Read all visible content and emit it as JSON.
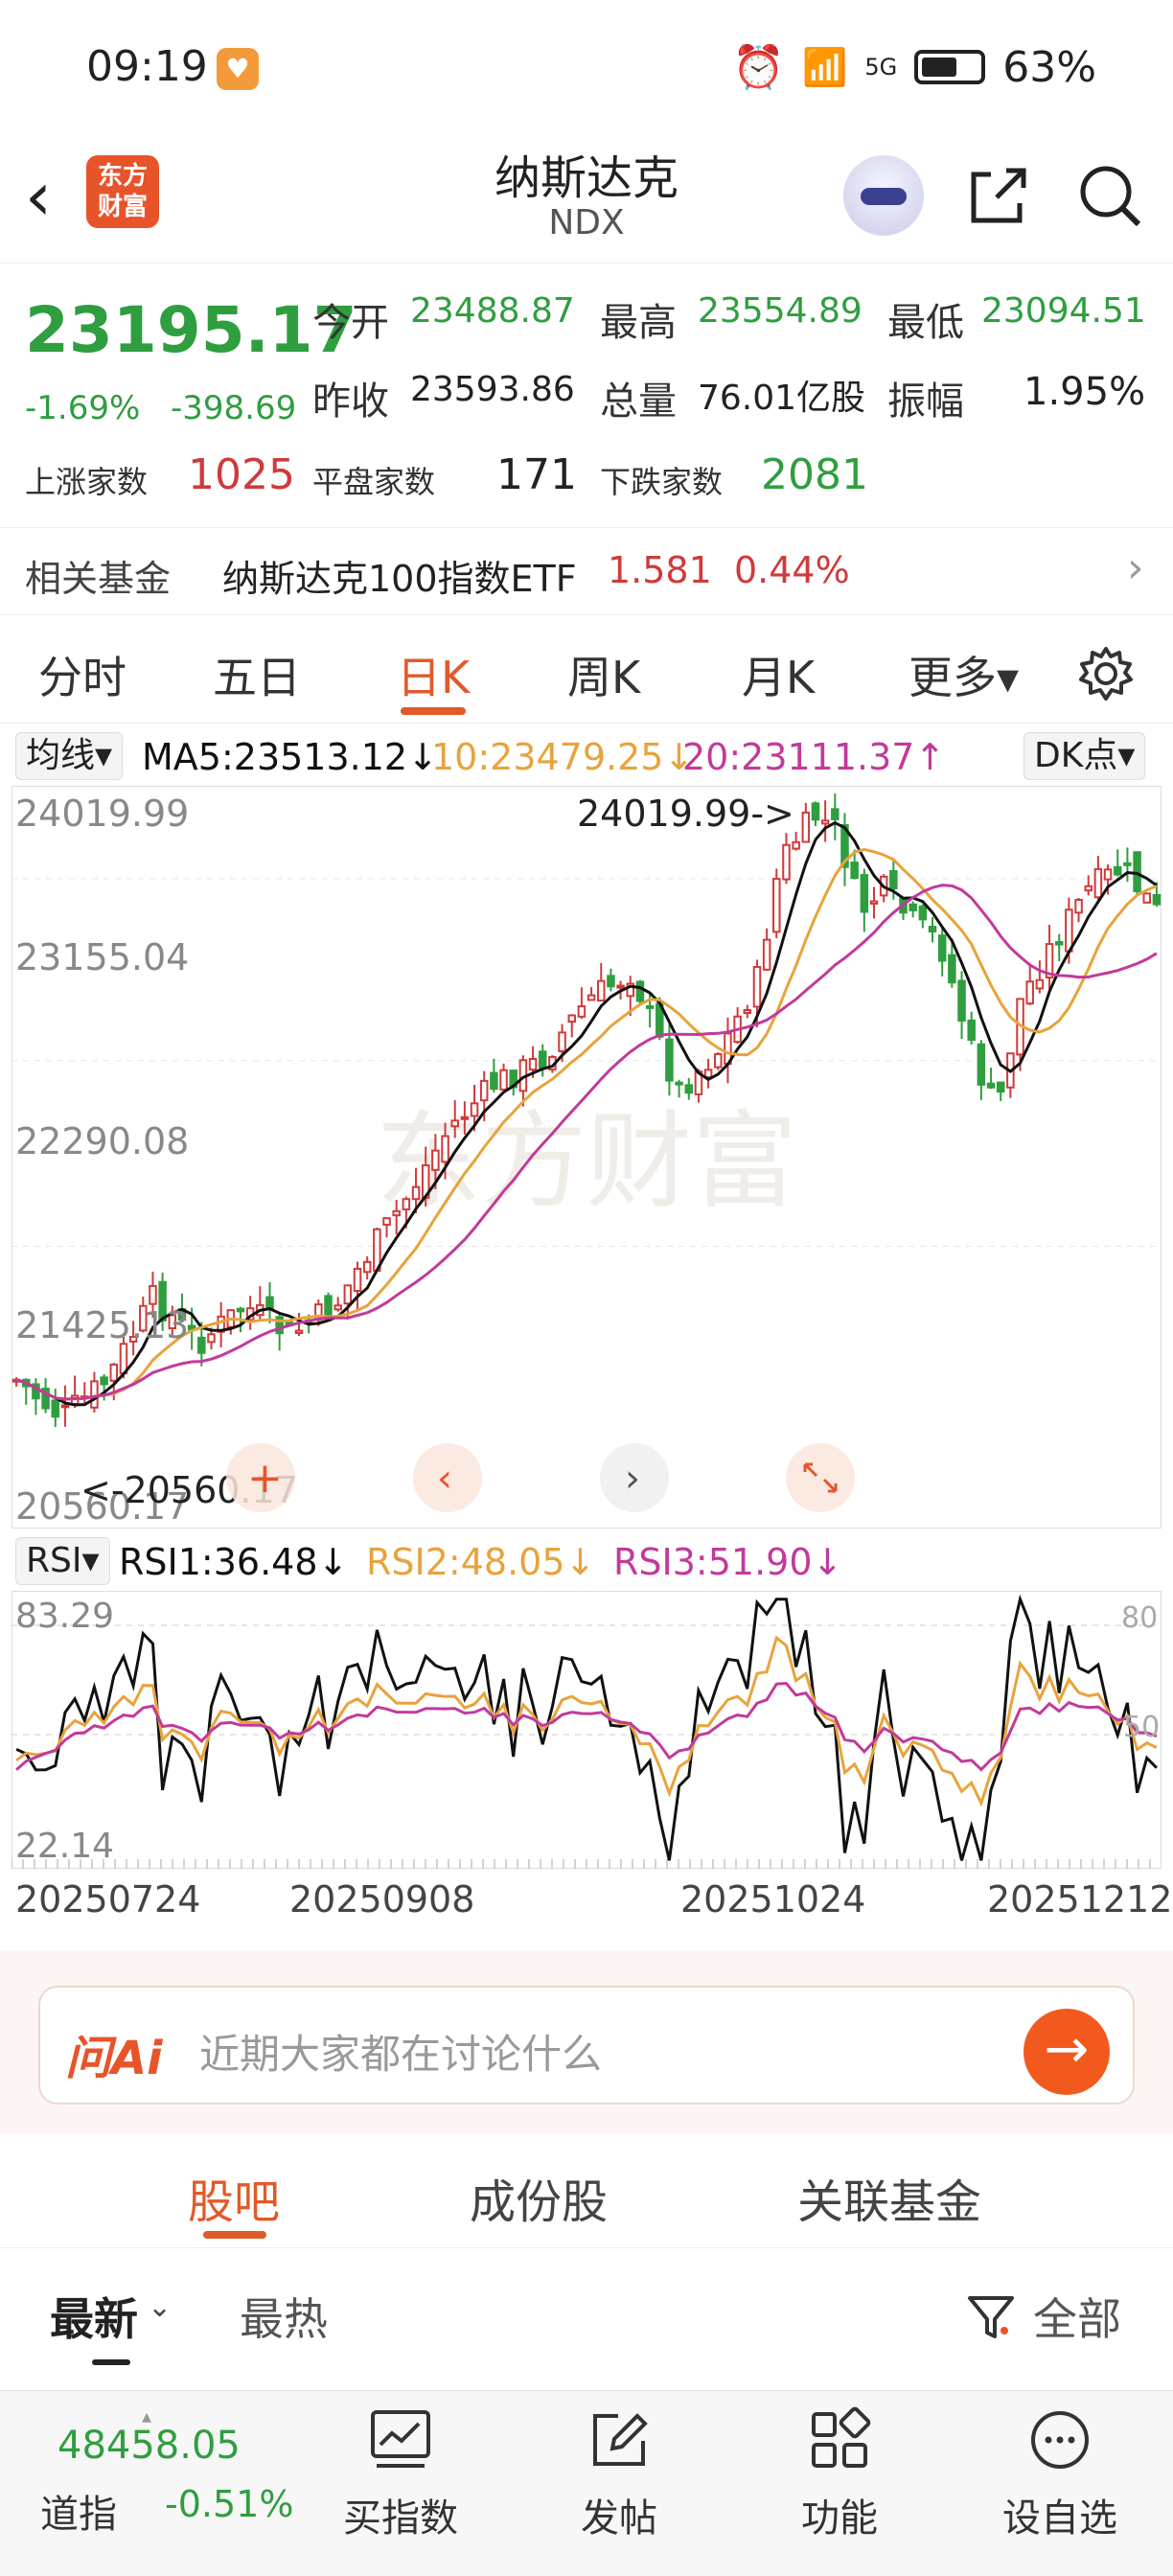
{
  "status_bar": {
    "time": "09:19",
    "signal": "5G",
    "battery": "63%"
  },
  "header": {
    "logo_text": "东方财富",
    "title": "纳斯达克",
    "subtitle": "NDX"
  },
  "quote": {
    "price": "23195.17",
    "change_pct": "-1.69%",
    "change_abs": "-398.69",
    "open_label": "今开",
    "open": "23488.87",
    "high_label": "最高",
    "high": "23554.89",
    "low_label": "最低",
    "low": "23094.51",
    "prev_close_label": "昨收",
    "prev_close": "23593.86",
    "volume_label": "总量",
    "volume": "76.01亿股",
    "amplitude_label": "振幅",
    "amplitude": "1.95%",
    "up_label": "上涨家数",
    "up_count": "1025",
    "flat_label": "平盘家数",
    "flat_count": "171",
    "down_label": "下跌家数",
    "down_count": "2081"
  },
  "fund": {
    "label": "相关基金",
    "name": "纳斯达克100指数ETF",
    "price": "1.581",
    "pct": "0.44%",
    "arrow": "›"
  },
  "period_tabs": [
    "分时",
    "五日",
    "日K",
    "周K",
    "月K",
    "更多▾"
  ],
  "active_period": "日K",
  "ma_legend": {
    "selector": "均线▾",
    "ma5": "MA5:23513.12↓",
    "ma10": "10:23479.25↓",
    "ma20": "20:23111.37↑",
    "dk_button": "DK点▾"
  },
  "kline": {
    "y_labels": [
      "24019.99",
      "23155.04",
      "22290.08",
      "21425.13",
      "20560.17"
    ],
    "max_annotation": "24019.99->",
    "min_annotation": "<-20560.17",
    "watermark": "东方财富",
    "colors": {
      "up": "#d03a3a",
      "down": "#2f9e3f",
      "ma5": "#111111",
      "ma10": "#e8a33c",
      "ma20": "#c23a9a"
    }
  },
  "rsi_legend": {
    "selector": "RSI▾",
    "rsi1": "RSI1:36.48↓",
    "rsi2": "RSI2:48.05↓",
    "rsi3": "RSI3:51.90↓"
  },
  "rsi": {
    "top_label": "83.29",
    "bottom_label": "22.14",
    "right_80": "80",
    "right_50": "50"
  },
  "dates": [
    "20250724",
    "20250908",
    "20251024",
    "20251212"
  ],
  "ai": {
    "logo": "问Ai",
    "placeholder": "近期大家都在讨论什么",
    "go": "→"
  },
  "sub_tabs": [
    "股吧",
    "成份股",
    "关联基金"
  ],
  "filters": {
    "latest": "最新",
    "hot": "最热",
    "all": "全部"
  },
  "bottom_nav": {
    "index_value": "48458.05",
    "index_name": "道指",
    "index_pct": "-0.51%",
    "items": [
      "买指数",
      "发帖",
      "功能",
      "设自选"
    ]
  }
}
